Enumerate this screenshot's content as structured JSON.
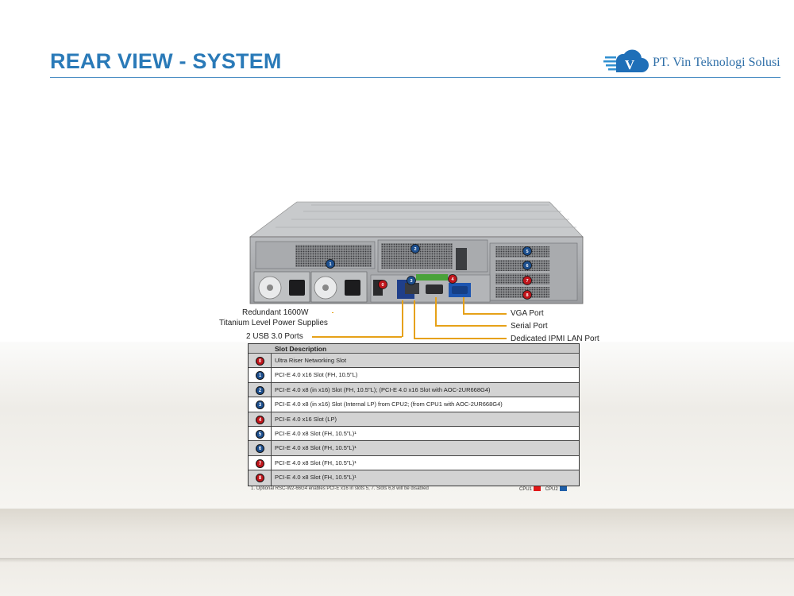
{
  "header": {
    "title": "REAR VIEW - SYSTEM",
    "logo_text": "PT. Vin Teknologi Solusi",
    "logo_mark_letter": "V",
    "accent_color": "#2a7ab8"
  },
  "callouts": {
    "power_line1": "Redundant 1600W",
    "power_line2": "Titanium Level Power Supplies",
    "usb": "2 USB 3.0 Ports",
    "vga": "VGA Port",
    "serial": "Serial Port",
    "ipmi": "Dedicated IPMI LAN Port"
  },
  "server_badges": [
    {
      "num": "0",
      "cpu": "CPU1"
    },
    {
      "num": "1",
      "cpu": "CPU2"
    },
    {
      "num": "2",
      "cpu": "CPU2"
    },
    {
      "num": "3",
      "cpu": "CPU2"
    },
    {
      "num": "4",
      "cpu": "CPU1"
    },
    {
      "num": "5",
      "cpu": "CPU2"
    },
    {
      "num": "6",
      "cpu": "CPU2"
    },
    {
      "num": "7",
      "cpu": "CPU1"
    },
    {
      "num": "8",
      "cpu": "CPU1"
    }
  ],
  "table": {
    "header": "Slot Description",
    "rows": [
      {
        "num": "0",
        "cpu": "CPU1",
        "desc": "Ultra Riser Networking Slot"
      },
      {
        "num": "1",
        "cpu": "CPU2",
        "desc": "PCI-E 4.0 x16 Slot (FH, 10.5\"L)"
      },
      {
        "num": "2",
        "cpu": "CPU2",
        "desc": "PCI-E 4.0 x8 (in x16) Slot (FH, 10.5\"L); (PCI-E 4.0 x16 Slot with AOC-2UR668G4)"
      },
      {
        "num": "3",
        "cpu": "CPU2",
        "desc": "PCI-E 4.0 x8 (in x16) Slot (Internal LP) from CPU2; (from CPU1 with AOC-2UR668G4)"
      },
      {
        "num": "4",
        "cpu": "CPU1",
        "desc": "PCI-E 4.0 x16 Slot (LP)"
      },
      {
        "num": "5",
        "cpu": "CPU2",
        "desc": "PCI-E 4.0 x8 Slot (FH, 10.5\"L)¹"
      },
      {
        "num": "6",
        "cpu": "CPU2",
        "desc": "PCI-E 4.0 x8 Slot (FH, 10.5\"L)¹"
      },
      {
        "num": "7",
        "cpu": "CPU1",
        "desc": "PCI-E 4.0 x8 Slot (FH, 10.5\"L)¹"
      },
      {
        "num": "8",
        "cpu": "CPU1",
        "desc": "PCI-E 4.0 x8 Slot (FH, 10.5\"L)¹"
      }
    ],
    "footnote": "1. Optional RSC-W2-66G4 enables PCI-E x16 in slots 5, 7.  Slots 6,8 will be disabled"
  },
  "cpu_legend": [
    {
      "label": "CPU1",
      "color": "#e01818"
    },
    {
      "label": "CPU2",
      "color": "#1f5fa8"
    }
  ],
  "badge_colors": {
    "CPU1": "#c0161c",
    "CPU2": "#1d4f8e"
  }
}
